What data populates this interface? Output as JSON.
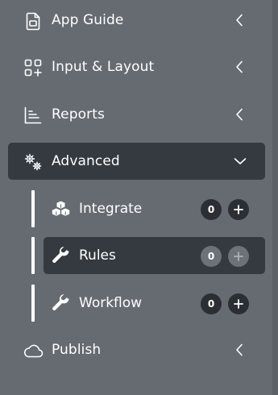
{
  "menu": {
    "app_guide": {
      "label": "App Guide",
      "icon": "document-icon"
    },
    "input_layout": {
      "label": "Input & Layout",
      "icon": "grid-add-icon"
    },
    "reports": {
      "label": "Reports",
      "icon": "chart-icon"
    },
    "advanced": {
      "label": "Advanced",
      "icon": "gears-icon",
      "expanded": true
    },
    "publish": {
      "label": "Publish",
      "icon": "cloud-icon"
    }
  },
  "advanced_items": [
    {
      "label": "Integrate",
      "count": "0",
      "icon": "cubes-icon"
    },
    {
      "label": "Rules",
      "count": "0",
      "icon": "wrench-icon",
      "active": true
    },
    {
      "label": "Workflow",
      "count": "0",
      "icon": "wrench-icon"
    }
  ],
  "colors": {
    "sidebar_bg": "#666b72",
    "active_bg": "#343a40",
    "badge_bg": "#2b2f34",
    "active_badge_bg": "#6d7279",
    "text": "#ffffff"
  }
}
